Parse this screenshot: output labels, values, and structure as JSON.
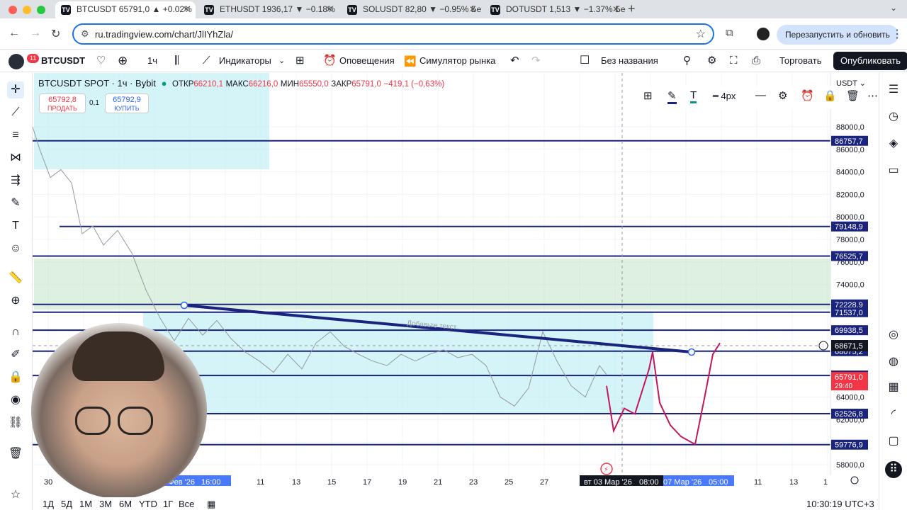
{
  "browser": {
    "tabs": [
      {
        "title": "BTCUSDT 65791,0 ▲ +0.02%",
        "active": true
      },
      {
        "title": "ETHUSDT 1936,17 ▼ −0.18%",
        "active": false
      },
      {
        "title": "SOLUSDT 82,80 ▼ −0.95% Бе",
        "active": false
      },
      {
        "title": "DOTUSDT 1,513 ▼ −1.37% Бе",
        "active": false
      }
    ],
    "url": "ru.tradingview.com/chart/JlIYhZla/",
    "restart_label": "Перезапустить и обновить"
  },
  "toolbar": {
    "badge": "11",
    "symbol": "BTCUSDT",
    "interval": "1ч",
    "indicators": "Индикаторы",
    "alerts": "Оповещения",
    "replay": "Симулятор рынка",
    "layout_name": "Без названия",
    "trade": "Торговать",
    "publish": "Опубликовать"
  },
  "legend": {
    "title": "BTCUSDT SPOT · 1ч · Bybit",
    "open_label": "ОТКР",
    "open": "66210,1",
    "high_label": "МАКС",
    "high": "66216,0",
    "low_label": "МИН",
    "low": "65550,0",
    "close_label": "ЗАКР",
    "close": "65791,0",
    "change": "−419,1 (−0,63%)"
  },
  "trade": {
    "sell_price": "65792,8",
    "sell_label": "ПРОДАТЬ",
    "spread": "0,1",
    "buy_price": "65792,9",
    "buy_label": "КУПИТЬ"
  },
  "drawing_toolbar": {
    "width_label": "4px"
  },
  "chart_data": {
    "type": "line",
    "currency": "USDT",
    "y_range": [
      57000,
      91000
    ],
    "y_ticks": [
      "88000,0",
      "86000,0",
      "84000,0",
      "82000,0",
      "80000,0",
      "78000,0",
      "76000,0",
      "74000,0",
      "64000,0",
      "62000,0",
      "58000,0"
    ],
    "x_ticks": [
      "30",
      "11",
      "13",
      "15",
      "17",
      "19",
      "21",
      "23",
      "25",
      "27",
      "11",
      "13",
      "1"
    ],
    "x_highlight_labels": [
      "06 Фев '26",
      "16:00",
      "вт 03 Мар '26",
      "08:00",
      "07 Мар '26",
      "05:00"
    ],
    "horizontal_levels": [
      {
        "label": "86757,7",
        "value": 86757.7
      },
      {
        "label": "79148,9",
        "value": 79148.9
      },
      {
        "label": "76525,7",
        "value": 76525.7
      },
      {
        "label": "72228,9",
        "value": 72228.9
      },
      {
        "label": "71537,0",
        "value": 71537.0
      },
      {
        "label": "69938,5",
        "value": 69938.5
      },
      {
        "label": "68075,2",
        "value": 68075.2
      },
      {
        "label": "65916,3",
        "value": 65916.3
      },
      {
        "label": "62526,8",
        "value": 62526.8
      },
      {
        "label": "59776,9",
        "value": 59776.9
      }
    ],
    "crosshair_price": "68671,5",
    "last_price": "65791,0",
    "countdown": "29:40",
    "trendline_text": "Добавьте текст",
    "price_path": [
      [
        0,
        88000
      ],
      [
        10,
        86000
      ],
      [
        25,
        83500
      ],
      [
        40,
        84200
      ],
      [
        55,
        83000
      ],
      [
        70,
        78500
      ],
      [
        85,
        79200
      ],
      [
        100,
        77500
      ],
      [
        120,
        78800
      ],
      [
        140,
        76800
      ],
      [
        160,
        73500
      ],
      [
        180,
        71000
      ],
      [
        200,
        69000
      ],
      [
        220,
        71000
      ],
      [
        240,
        69500
      ],
      [
        260,
        70800
      ],
      [
        280,
        69200
      ],
      [
        300,
        68000
      ],
      [
        320,
        67200
      ],
      [
        340,
        66200
      ],
      [
        360,
        67800
      ],
      [
        380,
        66500
      ],
      [
        400,
        68800
      ],
      [
        420,
        69800
      ],
      [
        440,
        68500
      ],
      [
        460,
        67800
      ],
      [
        480,
        67200
      ],
      [
        500,
        66800
      ],
      [
        520,
        67800
      ],
      [
        540,
        67200
      ],
      [
        560,
        67800
      ],
      [
        580,
        68200
      ],
      [
        600,
        67500
      ],
      [
        620,
        67800
      ],
      [
        640,
        66800
      ],
      [
        660,
        64000
      ],
      [
        680,
        63200
      ],
      [
        700,
        64800
      ],
      [
        720,
        69800
      ],
      [
        740,
        67200
      ],
      [
        760,
        65000
      ],
      [
        780,
        64000
      ],
      [
        800,
        66800
      ],
      [
        810,
        66000
      ]
    ],
    "projection_path": [
      [
        810,
        65000
      ],
      [
        820,
        61000
      ],
      [
        835,
        63000
      ],
      [
        850,
        62500
      ],
      [
        870,
        66500
      ],
      [
        875,
        68000
      ],
      [
        885,
        63500
      ],
      [
        900,
        61500
      ],
      [
        915,
        60500
      ],
      [
        935,
        59800
      ],
      [
        950,
        64500
      ],
      [
        960,
        67800
      ],
      [
        970,
        68800
      ]
    ]
  },
  "bottom": {
    "ranges": [
      "1Д",
      "5Д",
      "1М",
      "3М",
      "6М",
      "YTD",
      "1Г",
      "Все"
    ],
    "time": "10:30:19 UTC+3"
  }
}
